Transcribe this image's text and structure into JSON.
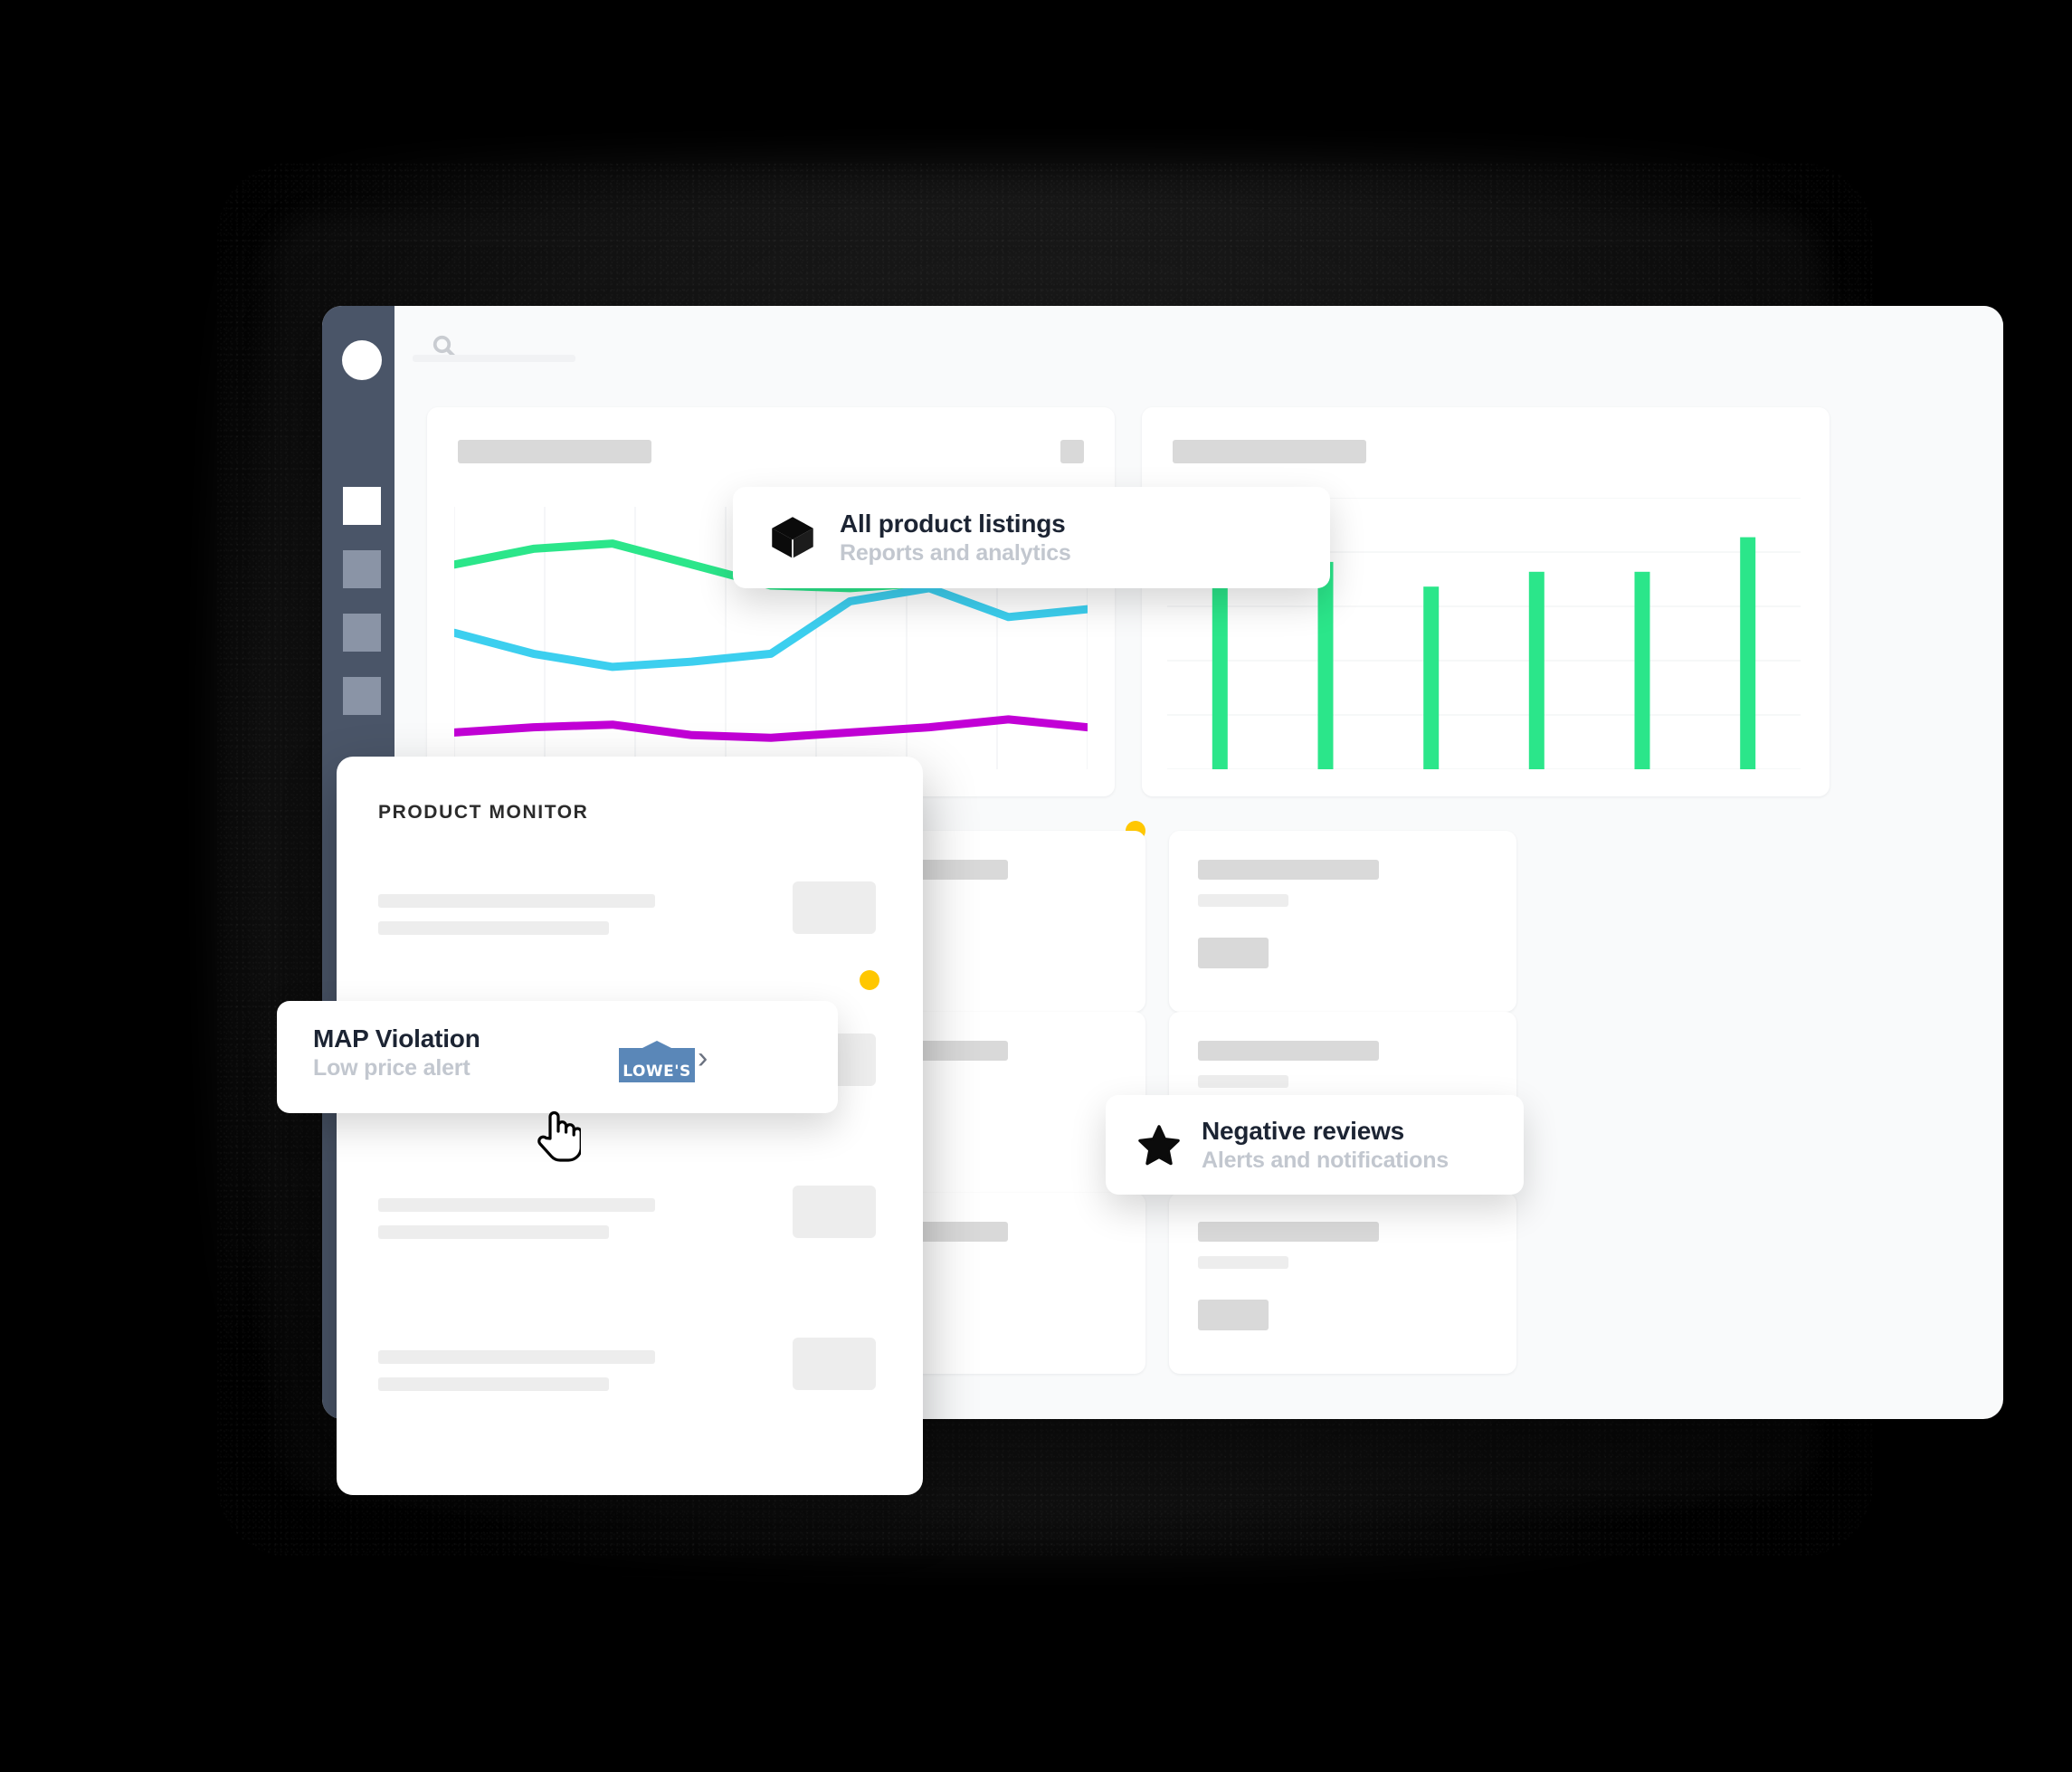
{
  "window": {
    "sidebar": {
      "avatar_name": "user-avatar",
      "items": [
        {
          "id": "dashboard",
          "state": "active"
        },
        {
          "id": "catalog",
          "state": "inactive"
        },
        {
          "id": "alerts",
          "state": "inactive"
        },
        {
          "id": "settings",
          "state": "inactive"
        }
      ]
    },
    "topbar": {
      "search_placeholder": ""
    }
  },
  "monitor_panel": {
    "heading": "PRODUCT MONITOR",
    "row_count": 4
  },
  "chips": {
    "listings": {
      "title": "All product listings",
      "subtitle": "Reports and analytics",
      "icon": "cube-icon"
    },
    "map_violation": {
      "title": "MAP Violation",
      "subtitle": "Low price alert",
      "retailer": "LOWE'S",
      "chevron": "›",
      "badge_color": "#FFC700"
    },
    "negative_reviews": {
      "title": "Negative reviews",
      "subtitle": "Alerts and notifications",
      "icon": "star-icon"
    }
  },
  "colors": {
    "sidebar": "#4A5568",
    "surface": "#F9FAFB",
    "card": "#FFFFFF",
    "green": "#2BE68A",
    "cyan": "#3CCFEF",
    "magenta": "#C200D6",
    "yellow": "#FFC700",
    "skeleton": "#D9D9D9",
    "skeleton_light": "#EDEDED",
    "lowes_blue": "#5A87B8"
  },
  "chart_data": [
    {
      "type": "line",
      "title": "",
      "xlabel": "",
      "ylabel": "",
      "grid": true,
      "legend": "none",
      "x": [
        0,
        1,
        2,
        3,
        4,
        5,
        6,
        7,
        8
      ],
      "xlim": [
        0,
        8
      ],
      "ylim": [
        0,
        100
      ],
      "series": [
        {
          "name": "series-green",
          "color": "#2BE68A",
          "values": [
            78,
            84,
            86,
            78,
            70,
            69,
            71,
            null,
            null
          ]
        },
        {
          "name": "series-cyan",
          "color": "#3CCFEF",
          "values": [
            52,
            44,
            39,
            41,
            44,
            64,
            69,
            58,
            61
          ]
        },
        {
          "name": "series-magenta",
          "color": "#C200D6",
          "values": [
            14,
            16,
            17,
            13,
            12,
            14,
            16,
            19,
            16
          ]
        }
      ]
    },
    {
      "type": "bar",
      "title": "",
      "xlabel": "",
      "ylabel": "",
      "grid": true,
      "categories": [
        "1",
        "2",
        "3",
        "4",
        "5",
        "6"
      ],
      "values": [
        100,
        84,
        74,
        80,
        80,
        94
      ],
      "ylim": [
        0,
        110
      ],
      "color": "#2BE68A"
    }
  ],
  "grid_cards": {
    "columns": 3,
    "rows": 3,
    "cells": [
      {
        "id": "c-0-0",
        "variant": "title-square",
        "badge": null
      },
      {
        "id": "c-0-1",
        "variant": "title-yellow",
        "badge": "#FFC700"
      },
      {
        "id": "c-0-2",
        "variant": "title-gray",
        "badge": null
      },
      {
        "id": "c-1-0",
        "variant": "title-square",
        "badge": null
      },
      {
        "id": "c-1-1",
        "variant": "title-faint",
        "badge": null
      },
      {
        "id": "c-1-2",
        "variant": "title-yellow",
        "badge": null
      },
      {
        "id": "c-2-0",
        "variant": "title-square",
        "badge": "#FFC700"
      },
      {
        "id": "c-2-1",
        "variant": "title-gray",
        "badge": null
      },
      {
        "id": "c-2-2",
        "variant": "title-gray",
        "badge": null
      }
    ]
  }
}
